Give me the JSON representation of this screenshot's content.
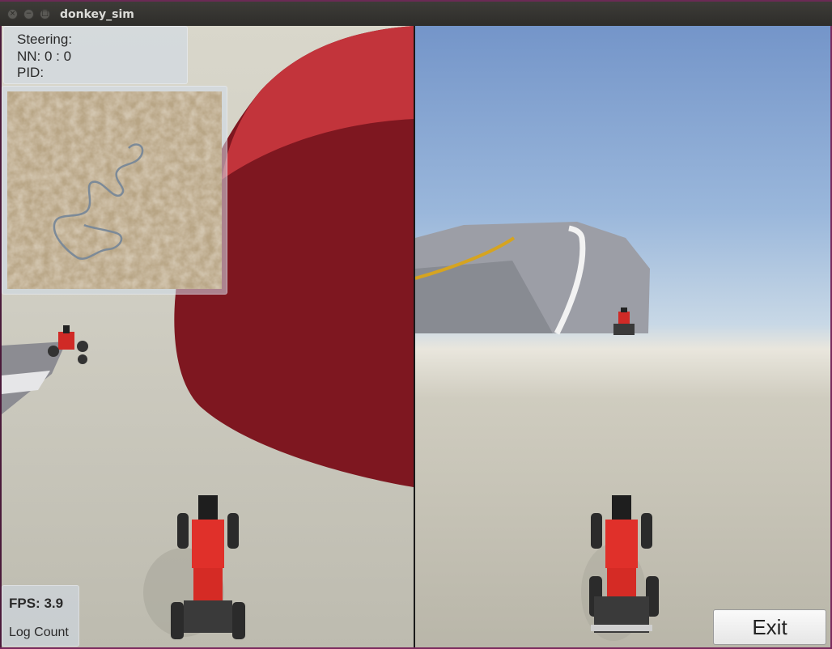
{
  "window": {
    "title": "donkey_sim",
    "controls": {
      "close": "×",
      "minimize": "−",
      "maximize": "□"
    }
  },
  "hud": {
    "steering_label": "Steering:",
    "nn_label": "NN: 0 : 0",
    "pid_label": "PID:",
    "fps_label": "FPS: 3.9",
    "log_count_label": "Log Count"
  },
  "buttons": {
    "exit_label": "Exit"
  },
  "colors": {
    "cone_red": "#8a1a22",
    "car_red": "#e0302a",
    "sky_blue": "#7495c9",
    "ground": "#c9c7bb"
  }
}
